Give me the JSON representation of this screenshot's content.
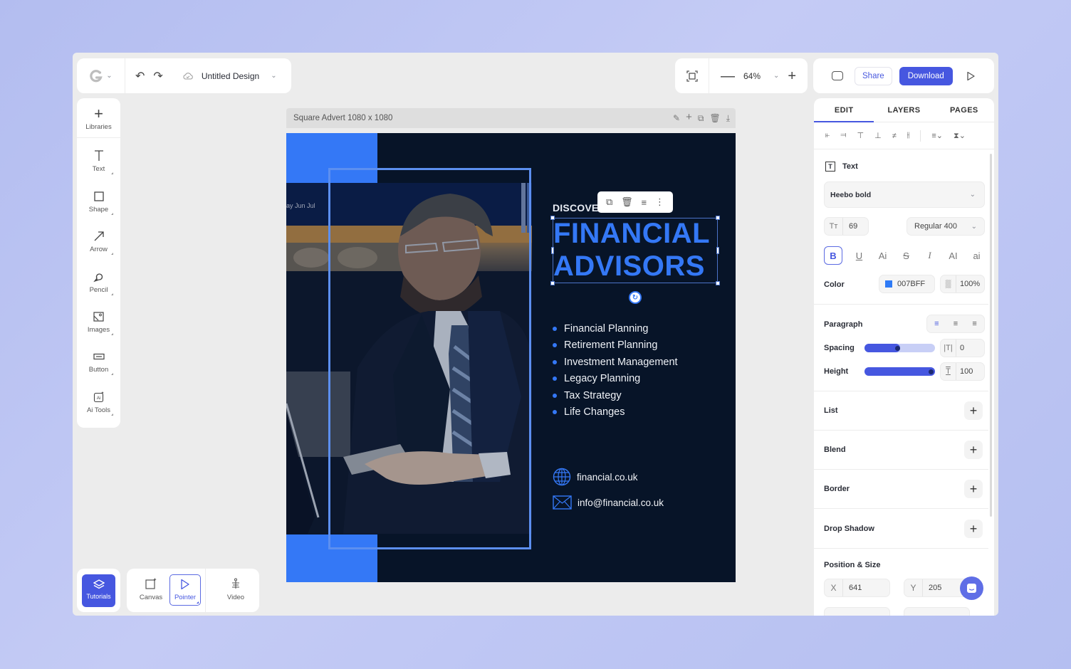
{
  "header": {
    "doc_title": "Untitled Design",
    "zoom_level": "64%",
    "share_label": "Share",
    "download_label": "Download"
  },
  "tools": [
    {
      "label": "Libraries",
      "icon": "plus-icon"
    },
    {
      "label": "Text",
      "icon": "text-icon"
    },
    {
      "label": "Shape",
      "icon": "square-icon"
    },
    {
      "label": "Arrow",
      "icon": "arrow-icon"
    },
    {
      "label": "Pencil",
      "icon": "pencil-icon"
    },
    {
      "label": "Images",
      "icon": "image-icon"
    },
    {
      "label": "Button",
      "icon": "button-icon"
    },
    {
      "label": "Ai Tools",
      "icon": "ai-icon"
    }
  ],
  "bottom_tools": {
    "tutorials": "Tutorials",
    "canvas": "Canvas",
    "pointer": "Pointer",
    "video": "Video"
  },
  "canvas": {
    "name": "Square Advert 1080 x 1080"
  },
  "design": {
    "eyebrow": "DISCOVER",
    "headline_line1": "FINANCIAL",
    "headline_line2": "ADVISORS",
    "services": [
      "Financial Planning",
      "Retirement Planning",
      "Investment Management",
      "Legacy Planning",
      "Tax Strategy",
      "Life Changes"
    ],
    "website": "financial.co.uk",
    "email": "info@financial.co.uk",
    "accent_color": "#3478f6",
    "background_color": "#071428"
  },
  "panel": {
    "tabs": [
      "EDIT",
      "LAYERS",
      "PAGES"
    ],
    "active_tab": "EDIT",
    "element_type": "Text",
    "font_family": "Heebo bold",
    "font_size": "69",
    "font_weight": "Regular 400",
    "format_buttons": [
      "B",
      "U",
      "Ai",
      "S",
      "I",
      "AI",
      "ai"
    ],
    "color_label": "Color",
    "color_value": "007BFF",
    "color_swatch": "#2f7bf6",
    "opacity": "100%",
    "paragraph_label": "Paragraph",
    "spacing_label": "Spacing",
    "spacing_value": "0",
    "spacing_fraction": 0.5,
    "height_label": "Height",
    "height_value": "100",
    "height_fraction": 1.0,
    "sections": [
      "List",
      "Blend",
      "Border",
      "Drop Shadow"
    ],
    "position_label": "Position & Size",
    "x_label": "X",
    "x_value": "641",
    "y_label": "Y",
    "y_value": "205"
  }
}
